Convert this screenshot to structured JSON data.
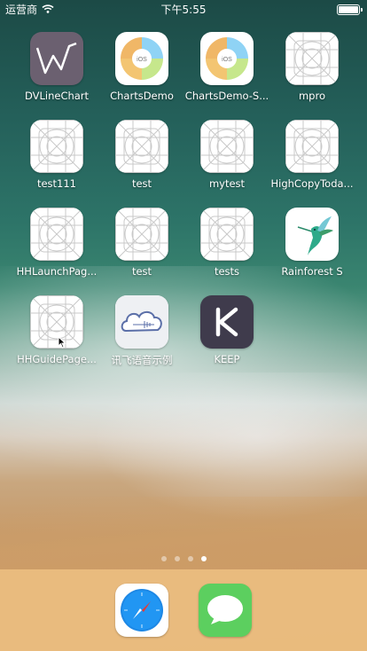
{
  "status_bar": {
    "carrier": "运营商",
    "time": "下午5:55"
  },
  "apps": [
    {
      "label": "DVLineChart",
      "icon": "dvlinechart-icon"
    },
    {
      "label": "ChartsDemo",
      "icon": "charts-pie-icon"
    },
    {
      "label": "ChartsDemo-S...",
      "icon": "charts-pie-icon"
    },
    {
      "label": "mpro",
      "icon": "placeholder-app-icon"
    },
    {
      "label": "test111",
      "icon": "placeholder-app-icon"
    },
    {
      "label": "test",
      "icon": "placeholder-app-icon"
    },
    {
      "label": "mytest",
      "icon": "placeholder-app-icon"
    },
    {
      "label": "HighCopyToda...",
      "icon": "placeholder-app-icon"
    },
    {
      "label": "HHLaunchPag...",
      "icon": "placeholder-app-icon"
    },
    {
      "label": "test",
      "icon": "placeholder-app-icon"
    },
    {
      "label": "tests",
      "icon": "placeholder-app-icon"
    },
    {
      "label": "Rainforest S",
      "icon": "hummingbird-icon"
    },
    {
      "label": "HHGuidePage...",
      "icon": "placeholder-app-icon"
    },
    {
      "label": "讯飞语音示例",
      "icon": "xunfei-cloud-icon"
    },
    {
      "label": "KEEP",
      "icon": "keep-icon"
    }
  ],
  "pie_icon_text": "iOS",
  "page_dots": {
    "count": 4,
    "active": 4
  },
  "dock": [
    {
      "icon": "safari-icon"
    },
    {
      "icon": "messages-icon"
    }
  ],
  "colors": {
    "dock": "#ecbe80",
    "keep": "#3f3b4c",
    "dv": "#6b6070"
  }
}
